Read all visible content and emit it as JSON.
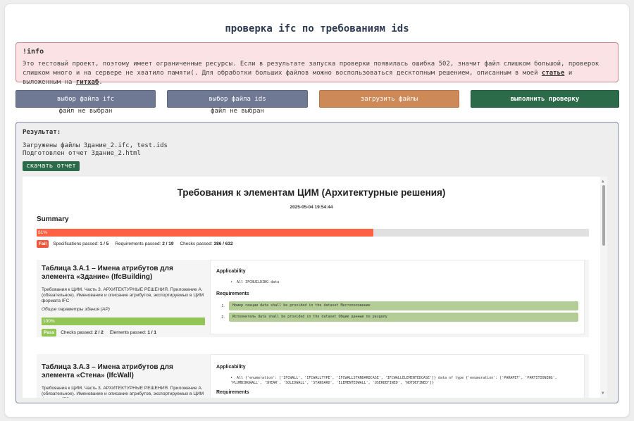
{
  "title": "проверка ifc по требованиям ids",
  "info": {
    "heading": "!info",
    "text_before": "Это тестовый проект, поэтому имеет ограниченные ресурсы. Если в результате запуска проверки появилась ошибка 502, значит файл слишком большой, проверок слишком много и на сервере не хватило памяти(. Для обработки больших файлов можно воспользоваться десктопным решением, описанным в моей ",
    "link_article": "статье",
    "text_middle": " и выложенным на ",
    "link_github": "гитхаб",
    "text_after": "."
  },
  "buttons": {
    "choose_ifc": "выбор файла ifc",
    "choose_ids": "выбор файла ids",
    "upload": "загрузить файлы",
    "run": "выполнить проверку"
  },
  "file_status": {
    "ifc": "файл не выбран",
    "ids": "файл не выбран"
  },
  "result": {
    "label": "Результат:",
    "line1": "Загружены файлы Здание_2.ifc, test.ids",
    "line2": "Подготовлен отчет Здание_2.html",
    "download": "скачать отчет"
  },
  "report": {
    "title": "Требования к элементам ЦИМ (Архитектурные решения)",
    "date": "2025-05-04 19:54:44",
    "summary_heading": "Summary",
    "progress_label": "61%",
    "progress_fraction": 0.61,
    "status_badge": "Fail",
    "spec_label": "Specifications passed: ",
    "spec_value": "1 / 5",
    "req_label": "Requirements passed: ",
    "req_value": "2 / 19",
    "checks_label": "Checks passed: ",
    "checks_value": "386 / 632",
    "blocks": [
      {
        "title": "Таблица 3.А.1 – Имена атрибутов для элемента «Здание» (IfcBuilding)",
        "description": "Требования к ЦИМ. Часть 3. АРХИТЕКТУРНЫЕ РЕШЕНИЯ. Приложение А. (обязательное). Именование и описание атрибутов, экспортируемых в ЦИМ формата IFC",
        "note": "Общие параметры здания (АР)",
        "progress_label": "100%",
        "progress_fraction": 1.0,
        "badge": "Pass",
        "checks_label": "Checks passed: ",
        "checks_value": "2 / 2",
        "elements_label": "Elements passed: ",
        "elements_value": "1 / 1",
        "applicability_heading": "Applicability",
        "applicability_item": "All IFCBUILDING data",
        "requirements_heading": "Requirements",
        "requirements": [
          {
            "num": "1.",
            "text": "Номер секции data shall be provided in the dataset Местоположение"
          },
          {
            "num": "2.",
            "text": "Исполнитель data shall be provided in the dataset Общие данные по разделу"
          }
        ]
      },
      {
        "title": "Таблица 3.А.3 – Имена атрибутов для элемента «Стена» (IfcWall)",
        "description": "Требования к ЦИМ. Часть 3. АРХИТЕКТУРНЫЕ РЕШЕНИЯ. Приложение А. (обязательное). Именование и описание атрибутов, экспортируемых в ЦИМ формата IFC",
        "applicability_heading": "Applicability",
        "applicability_item": "All {'enumeration': ['IFCWALL', 'IFCWALLTYPE', 'IFCWALLSTANDARDCASE', 'IFCWALLELEMENTEDCASE']} data of type {'enumeration': ['PARAPET', 'PARTITIONING', 'PLUMBINGWALL', 'SHEAR', 'SOLIDWALL', 'STANDARD', 'ELEMENTEDWALL', 'USERDEFINED', 'NOTDEFINED']}",
        "requirements_heading": "Requirements"
      }
    ]
  },
  "colors": {
    "info_bg": "#fbe3e5",
    "button_gray": "#6f7994",
    "button_orange": "#cd8a58",
    "button_green": "#2c6b4a",
    "fail_red": "#fc6143",
    "pass_green": "#93c556",
    "requirement_bg": "#b4cd96"
  }
}
